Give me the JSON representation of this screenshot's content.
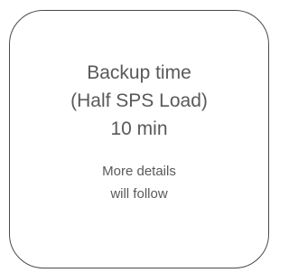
{
  "card": {
    "title_line1": "Backup time",
    "title_line2": "(Half SPS Load)",
    "value": "10 min",
    "note_line1": "More details",
    "note_line2": "will follow"
  }
}
